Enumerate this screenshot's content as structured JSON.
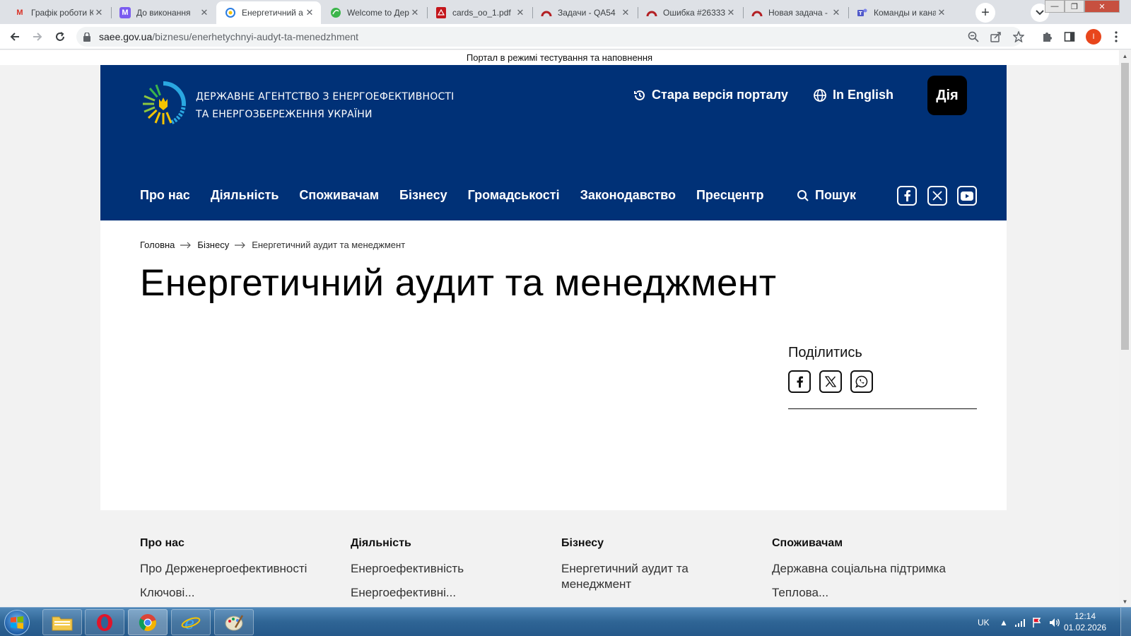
{
  "browser": {
    "tabs": [
      {
        "title": "Графік роботи К",
        "favicon": "gmail-icon"
      },
      {
        "title": "До виконання",
        "favicon": "m-icon"
      },
      {
        "title": "Енергетичний а",
        "favicon": "saee-icon"
      },
      {
        "title": "Welcome to Дер",
        "favicon": "green-leaf-icon"
      },
      {
        "title": "cards_oo_1.pdf",
        "favicon": "pdf-icon"
      },
      {
        "title": "Задачи - QA54",
        "favicon": "redmine-icon"
      },
      {
        "title": "Ошибка #26333",
        "favicon": "redmine-icon"
      },
      {
        "title": "Новая задача -",
        "favicon": "redmine-icon"
      },
      {
        "title": "Команды и кана",
        "favicon": "teams-icon"
      }
    ],
    "active_tab": 2,
    "url_domain": "saee.gov.ua",
    "url_path": "/biznesu/enerhetychnyi-audyt-ta-menedzhment",
    "profile_initial": "I"
  },
  "page": {
    "test_banner": "Портал в режимі тестування та наповнення",
    "agency_line1": "ДЕРЖАВНЕ АГЕНТСТВО З ЕНЕРГОЕФЕКТИВНОСТІ",
    "agency_line2": "ТА ЕНЕРГОЗБЕРЕЖЕННЯ УКРАЇНИ",
    "old_version": "Стара версія порталу",
    "in_english": "In English",
    "diia": "Дія",
    "nav": [
      "Про нас",
      "Діяльність",
      "Споживачам",
      "Бізнесу",
      "Громадськості",
      "Законодавство",
      "Пресцентр"
    ],
    "search": "Пошук",
    "breadcrumb": [
      "Головна",
      "Бізнесу",
      "Енергетичний аудит та менеджмент"
    ],
    "title": "Енергетичний аудит та менеджмент",
    "share_title": "Поділитись",
    "colors": {
      "header_bg": "#003177",
      "page_bg": "#f2f2f2",
      "diia_bg": "#000000"
    }
  },
  "footer": {
    "columns": [
      {
        "heading": "Про нас",
        "links": [
          "Про Держенергоефективності",
          "Ключові..."
        ]
      },
      {
        "heading": "Діяльність",
        "links": [
          "Енергоефективність",
          "Енергоефективні..."
        ]
      },
      {
        "heading": "Бізнесу",
        "links": [
          "Енергетичний аудит та менеджмент"
        ]
      },
      {
        "heading": "Споживачам",
        "links": [
          "Державна соціальна підтримка",
          "Теплова..."
        ]
      }
    ]
  },
  "taskbar": {
    "language": "UK",
    "time": "12:14",
    "date": "01.02.2026"
  }
}
